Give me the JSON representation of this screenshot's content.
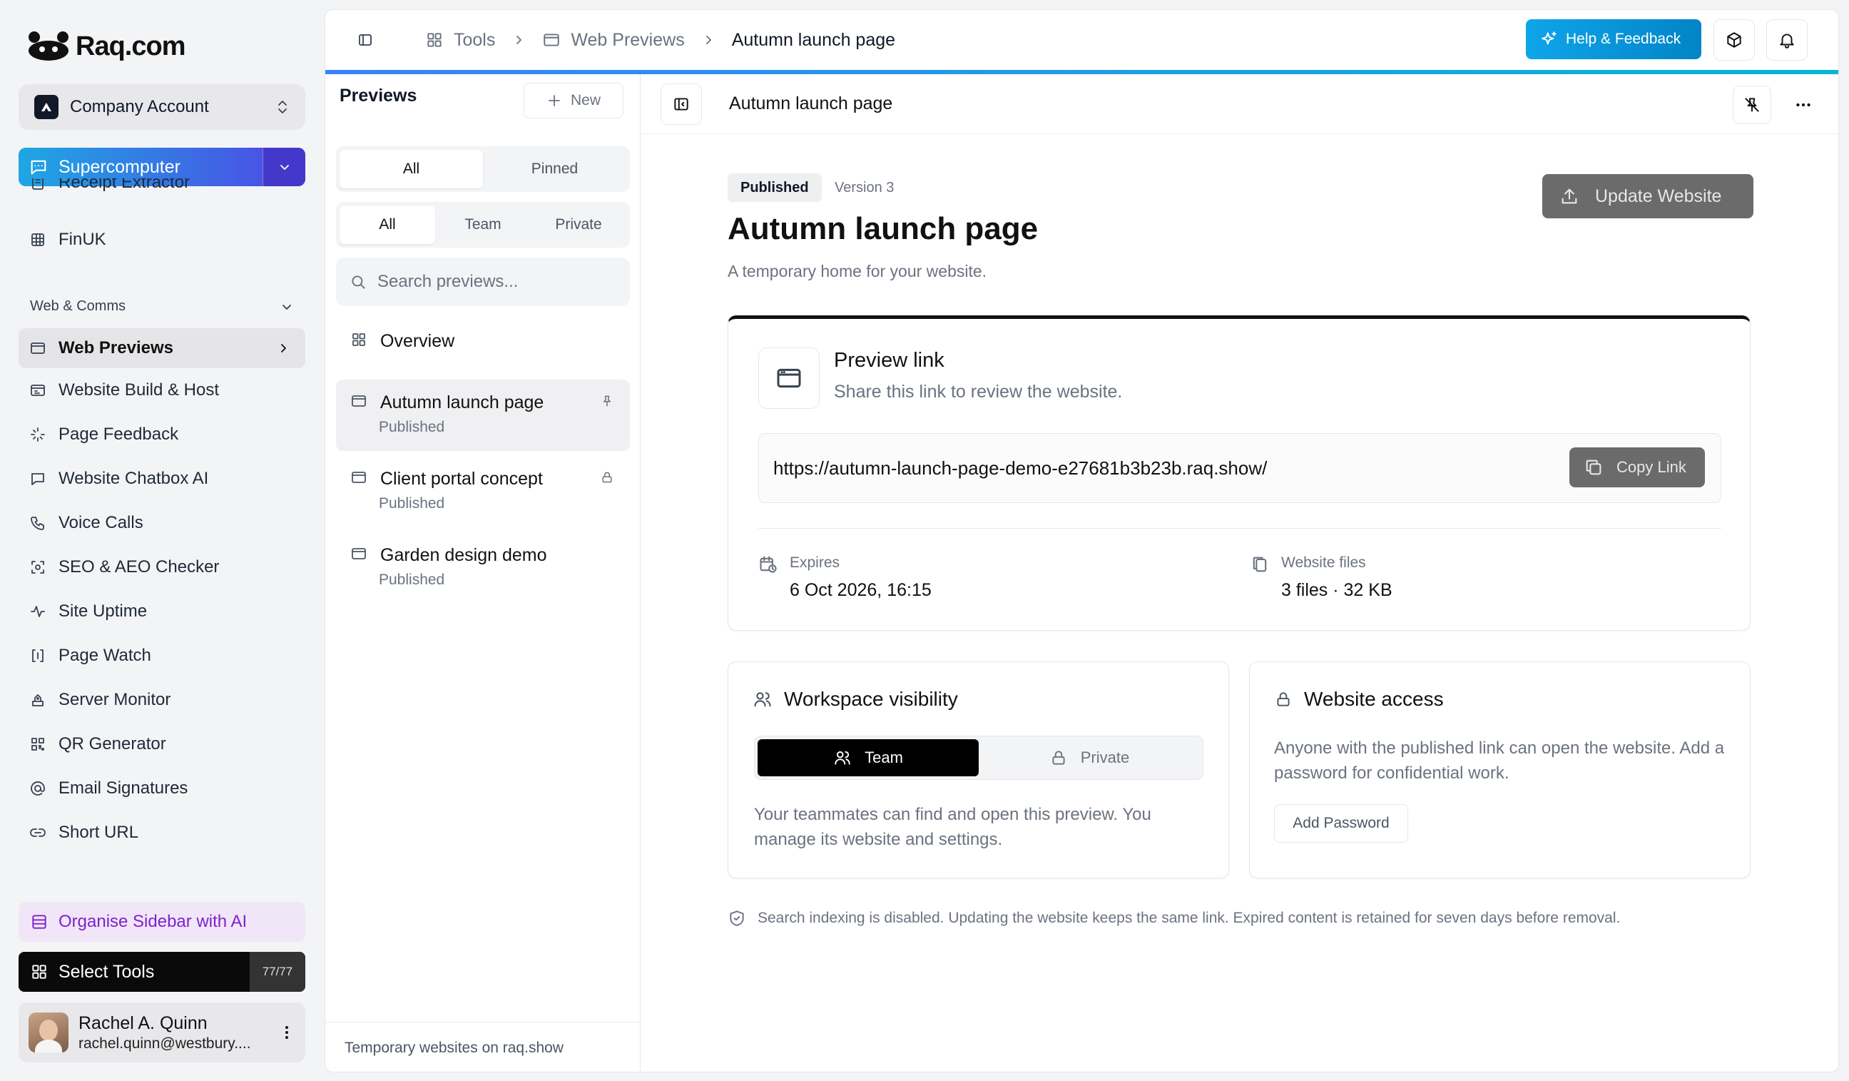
{
  "brand": {
    "name": "Raq.com"
  },
  "account": {
    "label": "Company Account"
  },
  "supercomputer": {
    "label": "Supercomputer"
  },
  "sidebar": {
    "top_items": [
      {
        "label": "Receipt Extractor",
        "icon": "receipt-icon"
      },
      {
        "label": "FinUK",
        "icon": "grid-icon"
      }
    ],
    "section_label": "Web & Comms",
    "items": [
      {
        "label": "Web Previews",
        "icon": "browser-icon"
      },
      {
        "label": "Website Build & Host",
        "icon": "build-icon"
      },
      {
        "label": "Page Feedback",
        "icon": "sparkle-icon"
      },
      {
        "label": "Website Chatbox AI",
        "icon": "chat-icon"
      },
      {
        "label": "Voice Calls",
        "icon": "phone-icon"
      },
      {
        "label": "SEO & AEO Checker",
        "icon": "scan-icon"
      },
      {
        "label": "Site Uptime",
        "icon": "pulse-icon"
      },
      {
        "label": "Page Watch",
        "icon": "watch-icon"
      },
      {
        "label": "Server Monitor",
        "icon": "server-icon"
      },
      {
        "label": "QR Generator",
        "icon": "qr-icon"
      },
      {
        "label": "Email Signatures",
        "icon": "at-icon"
      },
      {
        "label": "Short URL",
        "icon": "link-icon"
      }
    ],
    "organise": "Organise Sidebar with AI",
    "select_tools": "Select Tools",
    "tools_count": "77/77"
  },
  "user": {
    "name": "Rachel A. Quinn",
    "email": "rachel.quinn@westbury...."
  },
  "breadcrumb": {
    "root": "Tools",
    "parent": "Web Previews",
    "current": "Autumn launch page"
  },
  "header": {
    "help": "Help & Feedback"
  },
  "previews": {
    "title": "Previews",
    "new": "New",
    "tabs1": [
      "All",
      "Pinned"
    ],
    "tabs2": [
      "All",
      "Team",
      "Private"
    ],
    "search_placeholder": "Search previews...",
    "overview": "Overview",
    "items": [
      {
        "title": "Autumn launch page",
        "status": "Published"
      },
      {
        "title": "Client portal concept",
        "status": "Published"
      },
      {
        "title": "Garden design demo",
        "status": "Published"
      }
    ],
    "footer": "Temporary websites on raq.show"
  },
  "detail": {
    "header_title": "Autumn launch page",
    "status": "Published",
    "version": "Version 3",
    "title": "Autumn launch page",
    "subtitle": "A temporary home for your website.",
    "update_btn": "Update Website",
    "preview": {
      "title": "Preview link",
      "subtitle": "Share this link to review the website.",
      "url": "https://autumn-launch-page-demo-e27681b3b23b.raq.show/",
      "copy": "Copy Link",
      "expires_label": "Expires",
      "expires_value": "6 Oct 2026, 16:15",
      "files_label": "Website files",
      "files_value": "3 files · 32 KB"
    },
    "visibility": {
      "title": "Workspace visibility",
      "team": "Team",
      "private": "Private",
      "text": "Your teammates can find and open this preview. You manage its website and settings."
    },
    "access": {
      "title": "Website access",
      "text": "Anyone with the published link can open the website. Add a password for confidential work.",
      "button": "Add Password"
    },
    "note": "Search indexing is disabled. Updating the website keeps the same link. Expired content is retained for seven days before removal."
  }
}
